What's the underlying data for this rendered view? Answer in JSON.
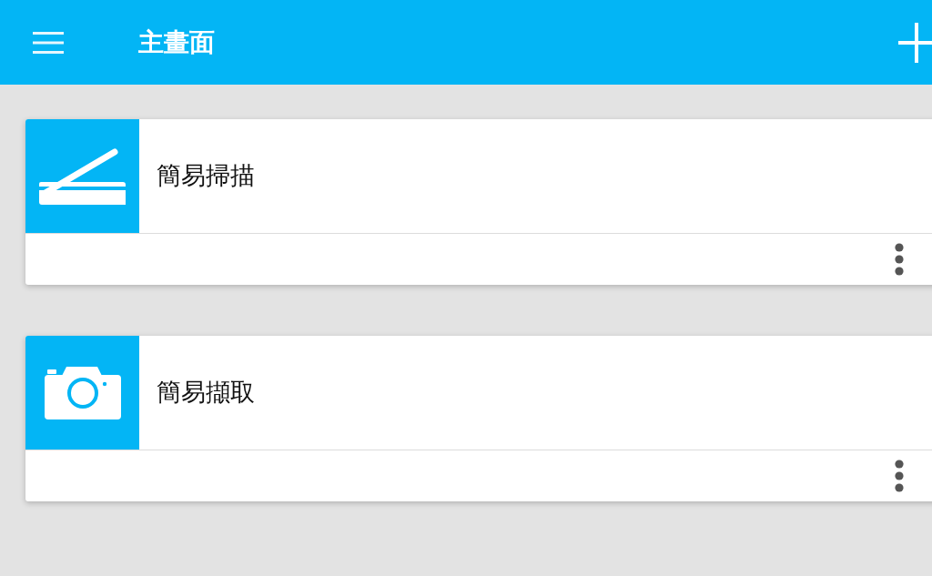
{
  "app_bar": {
    "title": "主畫面"
  },
  "cards": [
    {
      "kind": "scanner",
      "title": "簡易掃描"
    },
    {
      "kind": "camera",
      "title": "簡易擷取"
    }
  ]
}
